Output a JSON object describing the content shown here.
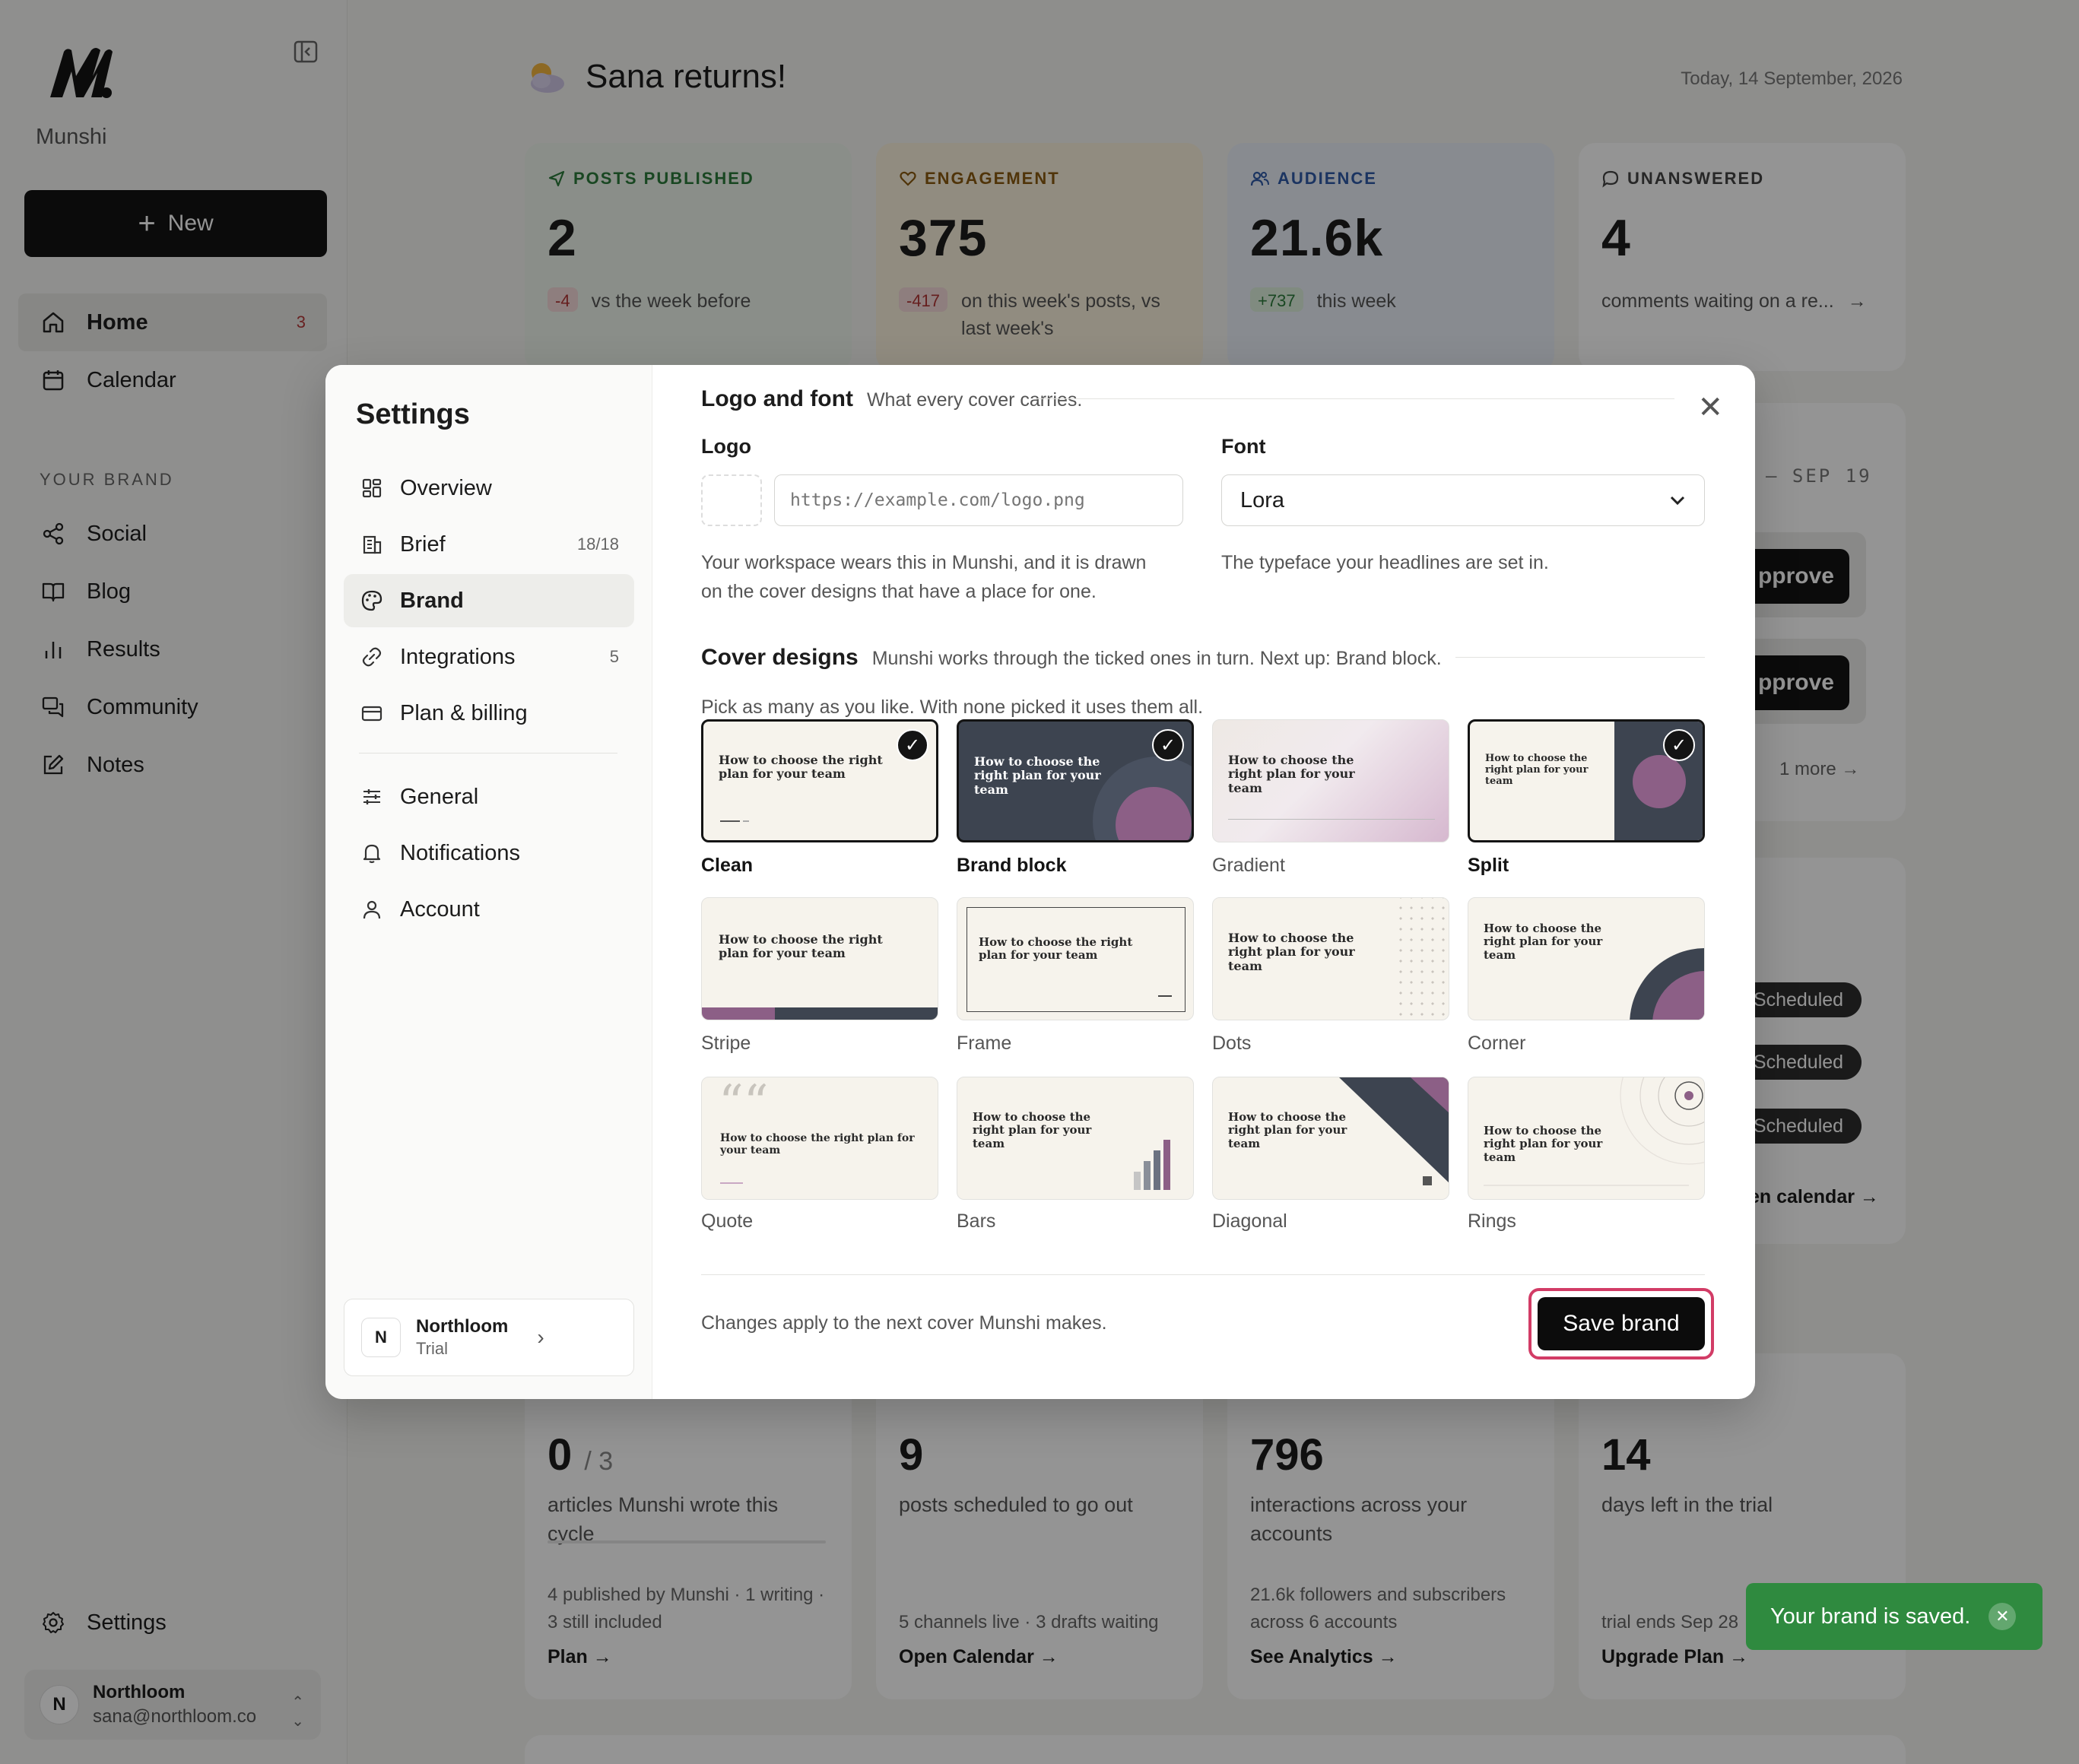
{
  "app": {
    "name": "Munshi",
    "new_label": "New",
    "greeting": "Sana returns!",
    "date": "Today, 14 September, 2026"
  },
  "sidebar": {
    "items": [
      {
        "label": "Home",
        "icon": "home-icon",
        "badge": "3"
      },
      {
        "label": "Calendar",
        "icon": "calendar-icon"
      }
    ],
    "section_label": "YOUR BRAND",
    "brand_items": [
      {
        "label": "Social",
        "icon": "share-icon"
      },
      {
        "label": "Blog",
        "icon": "book-icon"
      },
      {
        "label": "Results",
        "icon": "bar-chart-icon"
      },
      {
        "label": "Community",
        "icon": "chat-icon"
      },
      {
        "label": "Notes",
        "icon": "edit-icon"
      }
    ],
    "settings_label": "Settings",
    "account": {
      "initial": "N",
      "name": "Northloom",
      "email": "sana@northloom.co"
    }
  },
  "stats": [
    {
      "label": "POSTS PUBLISHED",
      "value": "2",
      "delta": "-4",
      "sub": "vs the week before",
      "color": "#2c7a3b",
      "bg": "#eef5ec"
    },
    {
      "label": "ENGAGEMENT",
      "value": "375",
      "delta": "-417",
      "sub": "on this week's posts, vs last week's",
      "color": "#8a5a10",
      "bg": "#faf1dc"
    },
    {
      "label": "AUDIENCE",
      "value": "21.6k",
      "delta": "+737",
      "sub": "this week",
      "color": "#2f5aa8",
      "bg": "#eaf0f8"
    },
    {
      "label": "UNANSWERED",
      "value": "4",
      "sub": "comments waiting on a re...",
      "color": "#444444",
      "bg": "#ffffff"
    }
  ],
  "bottom_cards": [
    {
      "value": "0",
      "value_suffix": "/ 3",
      "desc": "articles Munshi wrote this cycle",
      "foot": "4 published by Munshi · 1 writing · 3 still included",
      "link": "Plan →"
    },
    {
      "value": "9",
      "desc": "posts scheduled to go out",
      "foot": "5 channels live · 3 drafts waiting",
      "link": "Open Calendar →"
    },
    {
      "value": "796",
      "desc": "interactions across your accounts",
      "foot": "21.6k followers and subscribers across 6 accounts",
      "link": "See Analytics →"
    },
    {
      "value": "14",
      "desc": "days left in the trial",
      "foot": "trial ends Sep 28",
      "link": "Upgrade Plan →"
    }
  ],
  "right_panel": {
    "date_range": "– SEP 19",
    "approve_label": "pprove",
    "more": "1 more",
    "scheduled_label": "Scheduled",
    "open_calendar": "en calendar →"
  },
  "settings": {
    "title": "Settings",
    "nav": [
      {
        "label": "Overview",
        "icon": "grid-icon"
      },
      {
        "label": "Brief",
        "icon": "building-icon",
        "count": "18/18"
      },
      {
        "label": "Brand",
        "icon": "palette-icon",
        "active": true
      },
      {
        "label": "Integrations",
        "icon": "link-icon",
        "count": "5"
      },
      {
        "label": "Plan & billing",
        "icon": "card-icon"
      }
    ],
    "nav2": [
      {
        "label": "General",
        "icon": "sliders-icon"
      },
      {
        "label": "Notifications",
        "icon": "bell-icon"
      },
      {
        "label": "Account",
        "icon": "user-icon"
      }
    ],
    "org": {
      "initial": "N",
      "name": "Northloom",
      "plan": "Trial"
    },
    "logo_font": {
      "title": "Logo and font",
      "desc": "What every cover carries.",
      "logo_label": "Logo",
      "logo_placeholder": "https://example.com/logo.png",
      "logo_help": "Your workspace wears this in Munshi, and it is drawn on the cover designs that have a place for one.",
      "font_label": "Font",
      "font_value": "Lora",
      "font_help": "The typeface your headlines are set in."
    },
    "covers": {
      "title": "Cover designs",
      "desc": "Munshi works through the ticked ones in turn. Next up: Brand block.",
      "hint": "Pick as many as you like. With none picked it uses them all.",
      "sample_title": "How to choose the right plan for your team",
      "items": [
        {
          "name": "Clean",
          "selected": true
        },
        {
          "name": "Brand block",
          "selected": true
        },
        {
          "name": "Gradient",
          "selected": false
        },
        {
          "name": "Split",
          "selected": true
        },
        {
          "name": "Stripe",
          "selected": false
        },
        {
          "name": "Frame",
          "selected": false
        },
        {
          "name": "Dots",
          "selected": false
        },
        {
          "name": "Corner",
          "selected": false
        },
        {
          "name": "Quote",
          "selected": false
        },
        {
          "name": "Bars",
          "selected": false
        },
        {
          "name": "Diagonal",
          "selected": false
        },
        {
          "name": "Rings",
          "selected": false
        }
      ]
    },
    "footer_note": "Changes apply to the next cover Munshi makes.",
    "save_label": "Save brand"
  },
  "toast": {
    "message": "Your brand is saved."
  },
  "colors": {
    "accent_plum": "#8c5f86",
    "slate": "#3d4450",
    "highlight": "#d23c66",
    "toast_green": "#2f8a3f"
  }
}
